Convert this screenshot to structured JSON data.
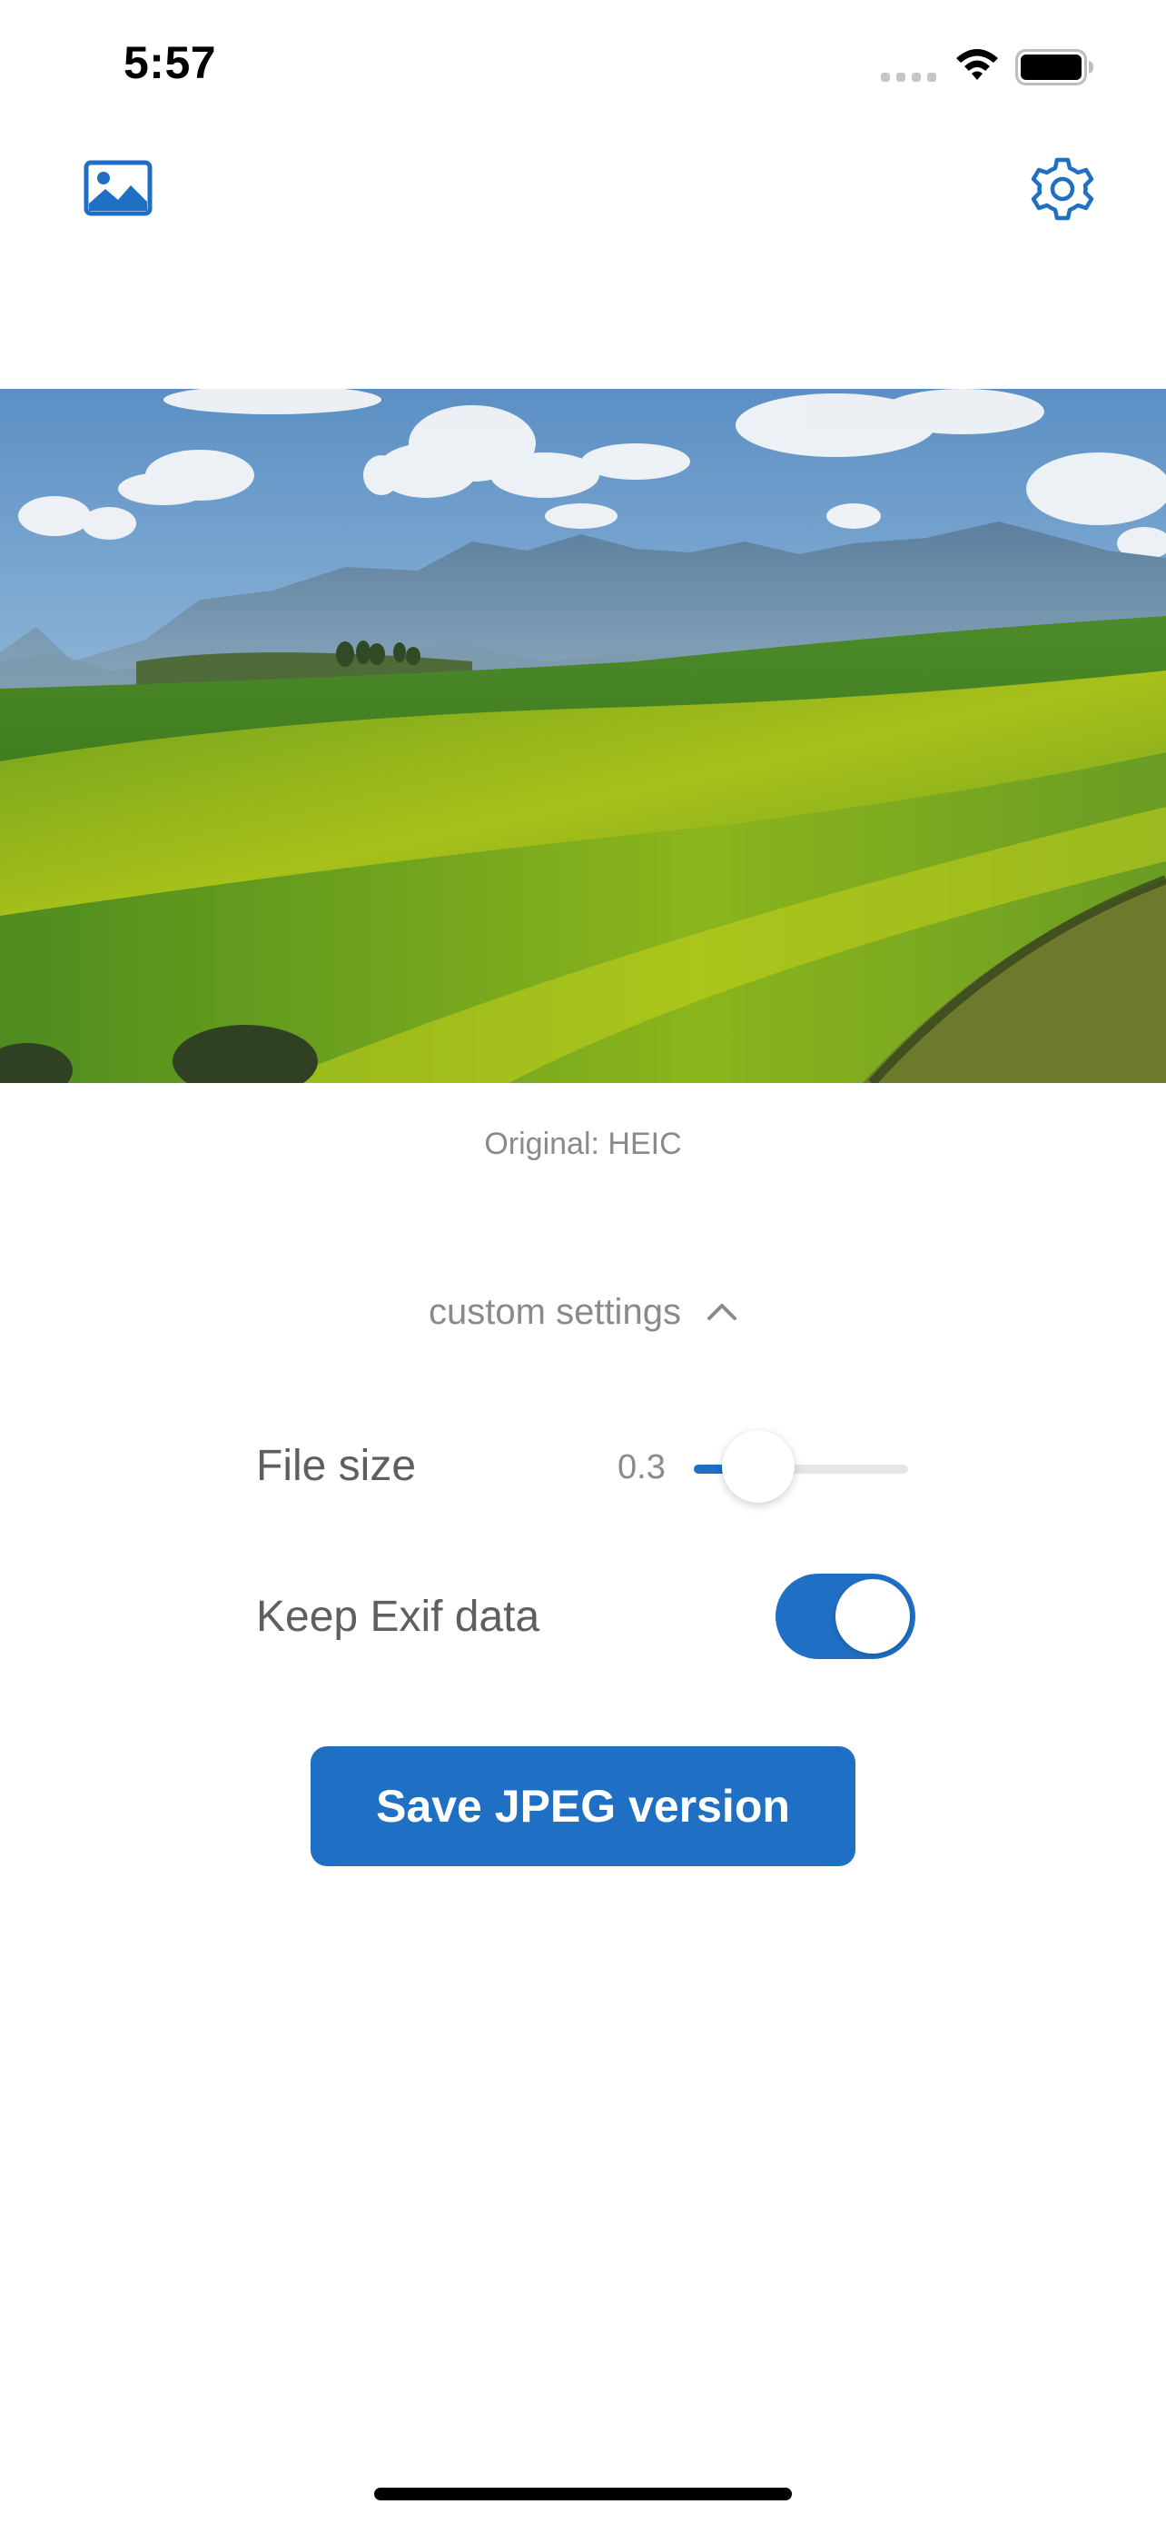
{
  "status_bar": {
    "time": "5:57",
    "icons": [
      "signal-icon",
      "wifi-icon",
      "battery-icon"
    ]
  },
  "toolbar": {
    "left_icon": "photo-gallery-icon",
    "right_icon": "gear-icon"
  },
  "image": {
    "original_format_label": "Original: HEIC"
  },
  "custom_settings": {
    "label": "custom settings",
    "expanded": true
  },
  "file_size": {
    "label": "File size",
    "value": "0.3",
    "slider_fraction": 0.3
  },
  "keep_exif": {
    "label": "Keep Exif data",
    "on": true
  },
  "save_button": {
    "label": "Save JPEG version"
  },
  "colors": {
    "accent": "#1f6fc5",
    "background": "#ffffff",
    "secondary_text": "#8a8a8a",
    "primary_text": "#5f5f5f"
  }
}
